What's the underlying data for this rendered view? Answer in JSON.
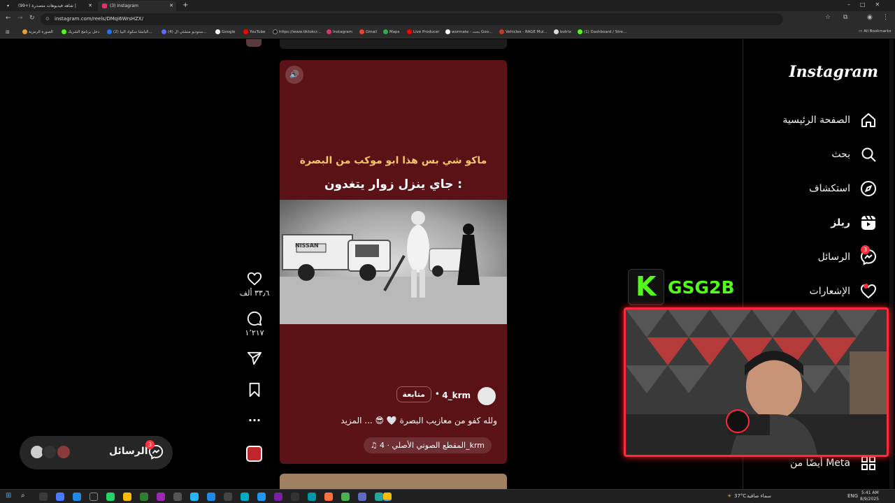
{
  "browser": {
    "tabs": [
      {
        "title": "(99+) شاهد فيديوهات متصدرة |",
        "active": false
      },
      {
        "title": "(3) Instagram",
        "active": true
      }
    ],
    "url": "instagram.com/reels/DMqi6WrsHZX/",
    "bookmarks": [
      "الصورة الرمزية",
      "دخل برنامج الشريك",
      "(2) البانشا سكواد البيا...",
      "(4) ستوديو منشئي ال...",
      "Google",
      "YouTube",
      "https://www.tiktokcr...",
      "Instagram",
      "Gmail",
      "Maps",
      "Live Producer",
      "wormate - بحث Goo...",
      "Vehicles - RAGE Mul...",
      "botrix",
      "(1) Dashboard / Stre..."
    ],
    "all_bookmarks": "All Bookmarks"
  },
  "sidebar": {
    "logo": "Instagram",
    "items": [
      {
        "label": "الصفحة الرئيسية",
        "icon": "home-icon"
      },
      {
        "label": "بحث",
        "icon": "search-icon"
      },
      {
        "label": "استكشاف",
        "icon": "compass-icon"
      },
      {
        "label": "ريلز",
        "icon": "reels-icon"
      },
      {
        "label": "الرسائل",
        "icon": "messenger-icon",
        "badge": "3"
      },
      {
        "label": "الإشعارات",
        "icon": "heart-icon"
      }
    ],
    "more": "أيضًا من Meta"
  },
  "reel": {
    "caption_line1": "ماكو شي بس هذا ابو موكب من البصرة",
    "caption_line2": "جاي ينزل زوار يتغدون :",
    "plate": "NISSAN",
    "author": "4_krm",
    "follow": "متابعة",
    "description": "ولله كفو من معازيب البصرة 🤍 😎 ... المزيد",
    "audio": "المقطع الصوتي الأصلي · 4_krm",
    "likes": "٣٣٫٦ ألف",
    "comments": "١٬٢١٧"
  },
  "messages_pill": {
    "label": "الرسائل",
    "badge": "3"
  },
  "overlay": {
    "brand": "GSG2B",
    "logo_letter": "K"
  },
  "taskbar": {
    "weather": "37°C",
    "weather_text": "سماء صافية",
    "lang": "ENG",
    "time": "5:41 AM",
    "date": "8/9/2025"
  },
  "colors": {
    "accent": "#ff3040",
    "reel_bg": "#5b1216",
    "brand_green": "#53fc18"
  }
}
